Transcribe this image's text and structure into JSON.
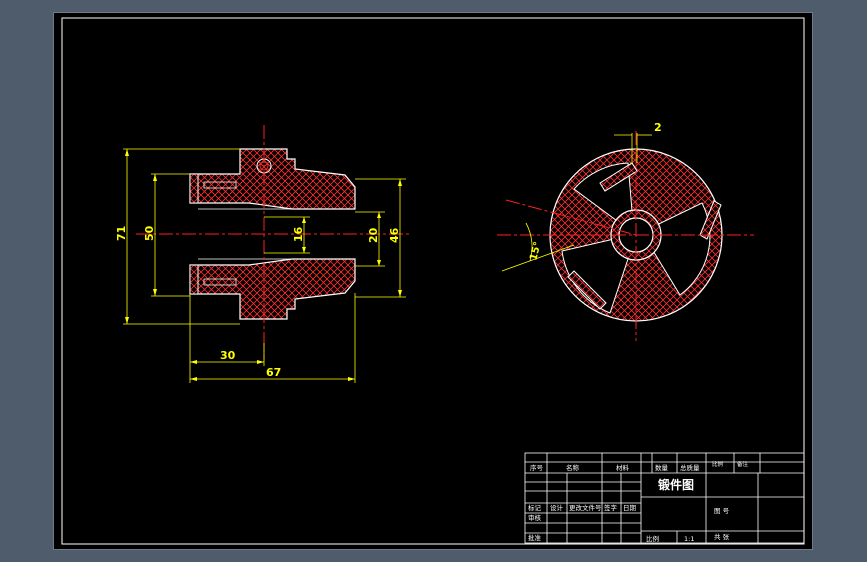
{
  "colors": {
    "background": "#4f5c6b",
    "paper": "#000000",
    "outline": "#ffffff",
    "dimension": "#ffff00",
    "centerline": "#ff2020",
    "hatch": "#ff3030"
  },
  "dimensions": {
    "d71": "71",
    "d50": "50",
    "d16": "16",
    "d20": "20",
    "d46": "46",
    "d30": "30",
    "d67": "67",
    "d2": "2",
    "d15": "15°"
  },
  "title_block": {
    "h_seq": "序号",
    "h_name": "名称",
    "h_material": "材料",
    "h_quantity": "数量",
    "h_weight": "总质量",
    "h_small1": "比例",
    "h_small2": "备注",
    "drawing_title": "锻件图",
    "designer": "设计",
    "review": "审核",
    "approve": "批准",
    "mark": "标记",
    "change_doc": "更改文件号",
    "sign": "签字",
    "date": "日期",
    "drawing_no_label": "图 号",
    "scale_label": "比例",
    "scale_value": "1:1",
    "sheet_label": "共 张"
  }
}
